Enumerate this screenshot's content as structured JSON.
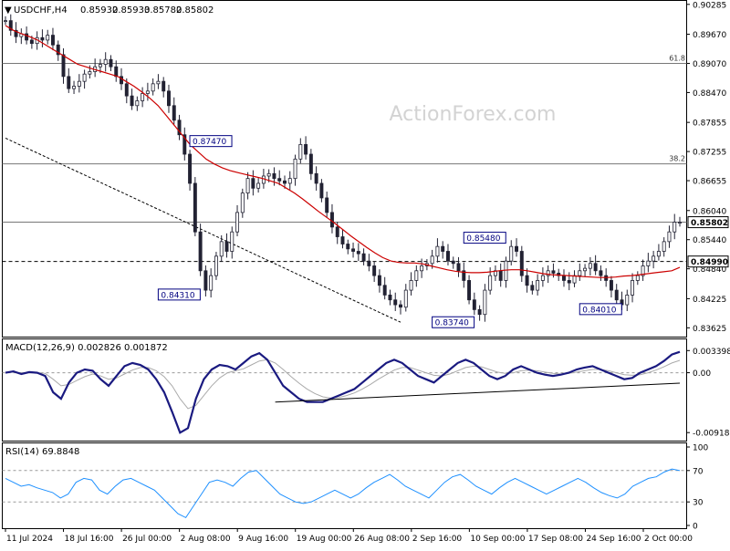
{
  "chart_data": [
    {
      "type": "candlestick",
      "panel": "price",
      "title": "USDCHF,H4",
      "ohlc_header": [
        "0.85932",
        "0.85933",
        "0.85782",
        "0.85802"
      ],
      "watermark": "ActionForex.com",
      "ylim": [
        0.835,
        0.903
      ],
      "y_ticks": [
        "0.90285",
        "0.89670",
        "0.89070",
        "0.88470",
        "0.87855",
        "0.87255",
        "0.86655",
        "0.86040",
        "0.85440",
        "0.84840",
        "0.84225",
        "0.83625"
      ],
      "x_labels": [
        "11 Jul 2024",
        "18 Jul 16:00",
        "26 Jul 00:00",
        "2 Aug 08:00",
        "9 Aug 16:00",
        "19 Aug 00:00",
        "26 Aug 08:00",
        "2 Sep 16:00",
        "10 Sep 00:00",
        "17 Sep 08:00",
        "24 Sep 16:00",
        "2 Oct 00:00"
      ],
      "close_series": [
        0.8995,
        0.8975,
        0.8962,
        0.8968,
        0.8955,
        0.8948,
        0.896,
        0.8955,
        0.8965,
        0.8945,
        0.8925,
        0.888,
        0.8855,
        0.886,
        0.887,
        0.8885,
        0.889,
        0.89,
        0.8905,
        0.8915,
        0.89,
        0.888,
        0.8865,
        0.884,
        0.882,
        0.883,
        0.8845,
        0.885,
        0.8865,
        0.887,
        0.885,
        0.882,
        0.879,
        0.876,
        0.872,
        0.866,
        0.856,
        0.848,
        0.844,
        0.847,
        0.851,
        0.854,
        0.852,
        0.856,
        0.86,
        0.864,
        0.867,
        0.865,
        0.866,
        0.8675,
        0.868,
        0.867,
        0.8665,
        0.866,
        0.867,
        0.871,
        0.874,
        0.872,
        0.868,
        0.866,
        0.863,
        0.86,
        0.857,
        0.855,
        0.8535,
        0.8525,
        0.852,
        0.8515,
        0.85,
        0.849,
        0.847,
        0.845,
        0.843,
        0.842,
        0.841,
        0.8405,
        0.844,
        0.846,
        0.848,
        0.849,
        0.8495,
        0.851,
        0.853,
        0.852,
        0.85,
        0.8495,
        0.848,
        0.846,
        0.842,
        0.84,
        0.839,
        0.844,
        0.847,
        0.848,
        0.846,
        0.85,
        0.853,
        0.852,
        0.847,
        0.845,
        0.844,
        0.846,
        0.847,
        0.848,
        0.8475,
        0.847,
        0.846,
        0.8455,
        0.847,
        0.848,
        0.8485,
        0.8495,
        0.848,
        0.847,
        0.846,
        0.844,
        0.842,
        0.841,
        0.843,
        0.846,
        0.847,
        0.849,
        0.85,
        0.851,
        0.852,
        0.854,
        0.856,
        0.858,
        0.858
      ],
      "sma_series": [
        0.8985,
        0.8975,
        0.8968,
        0.8962,
        0.8955,
        0.8945,
        0.8935,
        0.8925,
        0.8915,
        0.8905,
        0.89,
        0.8895,
        0.889,
        0.8885,
        0.888,
        0.887,
        0.886,
        0.8848,
        0.8835,
        0.882,
        0.88,
        0.878,
        0.876,
        0.874,
        0.8725,
        0.871,
        0.87,
        0.8692,
        0.8686,
        0.8682,
        0.8678,
        0.8674,
        0.867,
        0.8665,
        0.866,
        0.865,
        0.864,
        0.8628,
        0.8615,
        0.8602,
        0.859,
        0.8578,
        0.8565,
        0.8552,
        0.854,
        0.8528,
        0.8517,
        0.8507,
        0.85,
        0.8497,
        0.8496,
        0.8496,
        0.8494,
        0.849,
        0.8486,
        0.8482,
        0.8479,
        0.8477,
        0.8476,
        0.8476,
        0.8477,
        0.8479,
        0.8481,
        0.8482,
        0.8482,
        0.848,
        0.8477,
        0.8474,
        0.8472,
        0.8471,
        0.847,
        0.8469,
        0.8468,
        0.8467,
        0.8466,
        0.8466,
        0.8467,
        0.8469,
        0.847,
        0.8472,
        0.8474,
        0.8476,
        0.8478,
        0.848,
        0.8487
      ],
      "trendline": [
        [
          0.8753,
          0.8374
        ]
      ],
      "horizontal_levels": [
        {
          "value": 0.8907,
          "label": "61.8"
        },
        {
          "value": 0.87,
          "label": "38.2"
        },
        {
          "value": 0.858,
          "label": "0.85802"
        },
        {
          "value": 0.8499,
          "label": "0.84990",
          "style": "dashed"
        }
      ],
      "annotations": [
        "0.87470",
        "0.84310",
        "0.83740",
        "0.85480",
        "0.84010"
      ]
    },
    {
      "type": "line",
      "panel": "macd",
      "title": "MACD(12,26,9) 0.002826 0.001872",
      "ylim": [
        -0.01,
        0.004
      ],
      "y_ticks": [
        "0.003398",
        "0.00",
        "-0.009188"
      ],
      "macd_series": [
        0.0,
        0.0002,
        -0.0002,
        0.0001,
        0.0,
        -0.0005,
        -0.003,
        -0.004,
        -0.0015,
        0.0,
        0.0005,
        0.0003,
        -0.001,
        -0.002,
        -0.0005,
        0.001,
        0.0015,
        0.0012,
        0.0005,
        -0.001,
        -0.003,
        -0.006,
        -0.0092,
        -0.0085,
        -0.004,
        -0.001,
        0.0005,
        0.0012,
        0.001,
        0.0005,
        0.0015,
        0.0025,
        0.003,
        0.002,
        0.0,
        -0.002,
        -0.003,
        -0.004,
        -0.0045,
        -0.0045,
        -0.0045,
        -0.004,
        -0.0035,
        -0.003,
        -0.0025,
        -0.0015,
        -0.0005,
        0.0005,
        0.0015,
        0.002,
        0.0015,
        0.0005,
        -0.0005,
        -0.001,
        -0.0015,
        -0.0005,
        0.0005,
        0.0015,
        0.002,
        0.0015,
        0.0005,
        -0.0005,
        -0.001,
        -0.0005,
        0.0005,
        0.001,
        0.0005,
        0.0,
        -0.0003,
        -0.0005,
        -0.0003,
        0.0,
        0.0005,
        0.0008,
        0.001,
        0.0005,
        0.0,
        -0.0005,
        -0.001,
        -0.0008,
        0.0,
        0.0005,
        0.001,
        0.0018,
        0.0028,
        0.0032
      ],
      "signal_series": [
        0.0,
        0.0001,
        0.0,
        0.0,
        0.0,
        -0.0001,
        -0.001,
        -0.002,
        -0.0018,
        -0.0012,
        -0.0006,
        -0.0002,
        -0.0005,
        -0.001,
        -0.0008,
        -0.0002,
        0.0004,
        0.0008,
        0.0008,
        0.0003,
        -0.0006,
        -0.002,
        -0.004,
        -0.0055,
        -0.005,
        -0.0035,
        -0.002,
        -0.0008,
        0.0,
        0.0003,
        0.0006,
        0.0012,
        0.0018,
        0.002,
        0.0015,
        0.0005,
        -0.0006,
        -0.0016,
        -0.0025,
        -0.0032,
        -0.0037,
        -0.0039,
        -0.0038,
        -0.0035,
        -0.0031,
        -0.0025,
        -0.0018,
        -0.001,
        -0.0003,
        0.0004,
        0.0008,
        0.0008,
        0.0004,
        0.0,
        -0.0004,
        -0.0005,
        -0.0002,
        0.0003,
        0.0008,
        0.001,
        0.0009,
        0.0005,
        0.0001,
        -0.0001,
        0.0,
        0.0003,
        0.0004,
        0.0003,
        0.0001,
        -0.0001,
        -0.0002,
        -0.0001,
        0.0001,
        0.0003,
        0.0005,
        0.0005,
        0.0003,
        0.0,
        -0.0003,
        -0.0004,
        -0.0003,
        0.0,
        0.0004,
        0.0009,
        0.0015,
        0.0019
      ],
      "trendline": [
        [
          -0.0045,
          -0.0016
        ]
      ]
    },
    {
      "type": "line",
      "panel": "rsi",
      "title": "RSI(14) 69.8848",
      "ylim": [
        0,
        100
      ],
      "y_ticks": [
        "100",
        "70",
        "30",
        "0"
      ],
      "levels": [
        70,
        30
      ],
      "rsi_series": [
        60,
        55,
        50,
        52,
        48,
        45,
        42,
        35,
        40,
        55,
        60,
        58,
        45,
        40,
        50,
        58,
        60,
        55,
        50,
        45,
        35,
        25,
        15,
        10,
        25,
        40,
        55,
        58,
        55,
        50,
        60,
        68,
        70,
        60,
        50,
        40,
        35,
        30,
        28,
        30,
        35,
        40,
        45,
        40,
        35,
        40,
        48,
        55,
        60,
        65,
        58,
        50,
        45,
        40,
        35,
        45,
        55,
        62,
        65,
        58,
        50,
        45,
        40,
        48,
        55,
        60,
        55,
        50,
        45,
        40,
        45,
        50,
        55,
        60,
        55,
        48,
        42,
        38,
        35,
        40,
        50,
        55,
        60,
        62,
        68,
        72,
        69.9
      ]
    }
  ]
}
